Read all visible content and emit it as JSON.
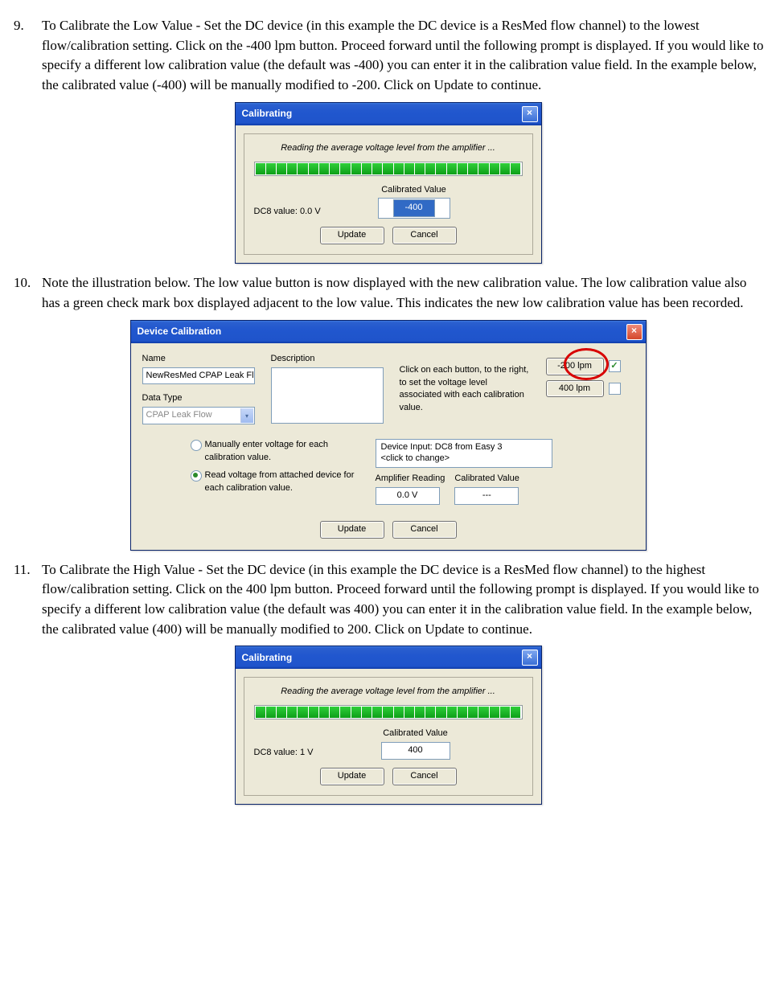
{
  "items": [
    {
      "number": "9.",
      "text": "To Calibrate the Low Value - Set the DC device (in this example the DC device is a ResMed flow channel) to the lowest flow/calibration setting.  Click on the -400 lpm button.  Proceed forward until the following prompt is displayed.  If you would like to specify a different low calibration value (the default was -400) you can enter it in the calibration value field.  In the example below, the calibrated value (-400) will be manually modified to -200.  Click on Update to continue."
    },
    {
      "number": "10.",
      "text": "Note the illustration below.  The low value button is now displayed with the new calibration value.  The low calibration value also has a green check mark box displayed adjacent to the low value.  This indicates the new low calibration value has been recorded."
    },
    {
      "number": "11.",
      "text": "To Calibrate the High Value - Set the DC device (in this example the DC device is a ResMed flow channel) to the highest flow/calibration setting.  Click on the 400 lpm button.  Proceed forward until the following prompt is displayed.  If you would like to specify a different low calibration value (the default was 400) you can enter it in the calibration value field.  In the example below, the calibrated value (400) will be manually modified to 200.  Click on Update to continue."
    }
  ],
  "dialog1": {
    "title": "Calibrating",
    "status_text": "Reading the average voltage level from the amplifier ...",
    "dc_label": "DC8 value:  0.0 V",
    "calib_label": "Calibrated Value",
    "calib_value": "-400",
    "update": "Update",
    "cancel": "Cancel"
  },
  "dialog2": {
    "title": "Device Calibration",
    "name_label": "Name",
    "name_value": "NewResMed CPAP Leak Flow",
    "desc_label": "Description",
    "desc_value": "",
    "datatype_label": "Data Type",
    "datatype_value": "CPAP Leak Flow",
    "instruction": "Click on each button, to the right, to set the voltage level associated with each calibration value.",
    "btn_low": "-200 lpm",
    "btn_high": "400 lpm",
    "radio1": "Manually enter voltage for each calibration value.",
    "radio2": "Read voltage from attached device for each calibration value.",
    "device_input_l1": "Device Input: DC8 from Easy 3",
    "device_input_l2": "<click to change>",
    "amp_label": "Amplifier Reading",
    "amp_value": "0.0 V",
    "cal_label": "Calibrated Value",
    "cal_value": "---",
    "update": "Update",
    "cancel": "Cancel"
  },
  "dialog3": {
    "title": "Calibrating",
    "status_text": "Reading the average voltage level from the amplifier ...",
    "dc_label": "DC8 value:   1  V",
    "calib_label": "Calibrated Value",
    "calib_value": "400",
    "update": "Update",
    "cancel": "Cancel"
  }
}
